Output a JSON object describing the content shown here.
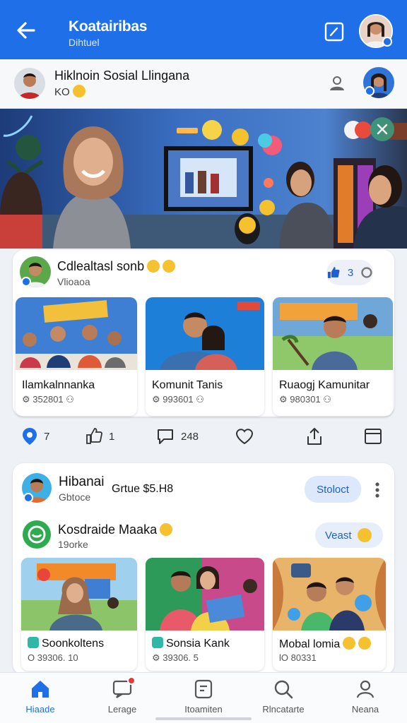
{
  "header": {
    "title": "Koatairibas",
    "subtitle": "Dihtuel"
  },
  "profile": {
    "name": "Hiklnoin Sosial Llingana",
    "sub": "KO"
  },
  "post1": {
    "title": "Cdlealtasl sonb",
    "sub": "Vlioaoa",
    "reaction_count": "3",
    "tiles": [
      {
        "title": "Ilamkalnnanka",
        "stats": "352801"
      },
      {
        "title": "Komunit Tanis",
        "stats": "993601"
      },
      {
        "title": "Ruaogj Kamunitar",
        "stats": "980301"
      }
    ]
  },
  "actions": {
    "location": "7",
    "like": "1",
    "comment": "248"
  },
  "post2": {
    "title": "Hibanai",
    "caption": "Grtue $5.H8",
    "sub": "Gbtoce",
    "follow_label": "Stoloct"
  },
  "sub_post": {
    "title": "Kosdraide Maaka",
    "sub": "19orke",
    "button_label": "Veast"
  },
  "tiles2": [
    {
      "title": "Soonkoltens",
      "stats": "O 39306. 10"
    },
    {
      "title": "Sonsia Kank",
      "stats": "39306. 5"
    },
    {
      "title": "Mobal lomia",
      "stats": "lO 80331"
    }
  ],
  "nav": [
    {
      "label": "Hiaade",
      "icon": "home-icon"
    },
    {
      "label": "Lerage",
      "icon": "message-icon"
    },
    {
      "label": "Itoamiten",
      "icon": "document-icon"
    },
    {
      "label": "Rlncatarte",
      "icon": "search-icon"
    },
    {
      "label": "Neana",
      "icon": "profile-icon"
    }
  ],
  "colors": {
    "accent": "#1f6fe8",
    "badge": "#e53935",
    "follow_bg": "#dde9fb"
  }
}
